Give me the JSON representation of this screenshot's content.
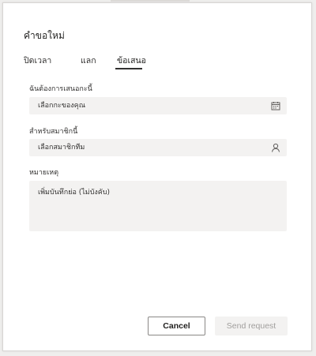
{
  "dialog": {
    "title": "คำขอใหม่"
  },
  "tabs": [
    {
      "label": "ปิดเวลา",
      "selected": false
    },
    {
      "label": "แลก",
      "selected": false
    },
    {
      "label": "ข้อเสนอ",
      "selected": true
    }
  ],
  "form": {
    "shift": {
      "label": "ฉันต้องการเสนอกะนี้",
      "value": "เลือกกะของคุณ",
      "icon": "calendar-icon"
    },
    "member": {
      "label": "สำหรับสมาชิกนี้",
      "value": "เลือกสมาชิกทีม",
      "icon": "person-icon"
    },
    "notes": {
      "label": "หมายเหตุ",
      "value": "เพิ่มบันทึกย่อ (ไม่บังคับ)"
    }
  },
  "buttons": {
    "cancel": "Cancel",
    "send": "Send request"
  },
  "colors": {
    "field_bg": "#f3f2f1",
    "text": "#323130",
    "disabled_text": "#a19f9d"
  }
}
